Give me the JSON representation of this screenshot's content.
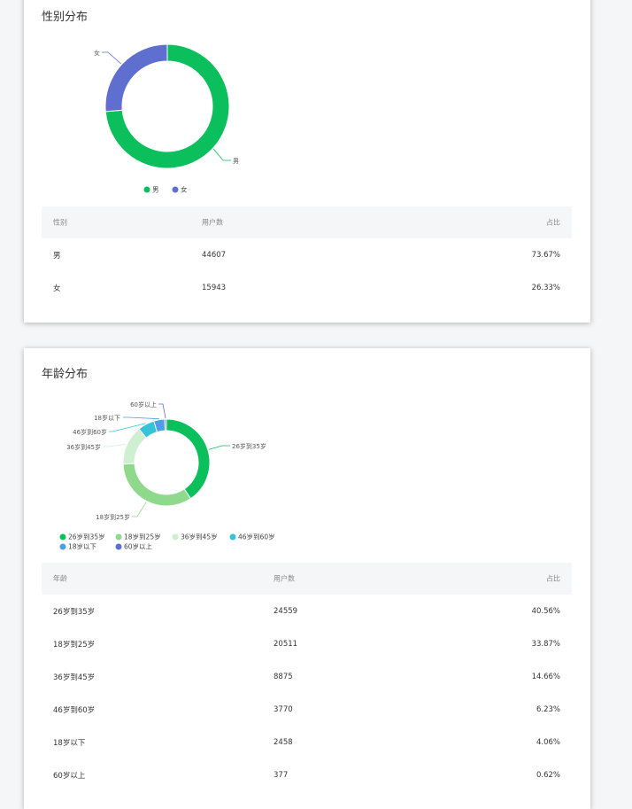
{
  "gender": {
    "title": "性别分布",
    "table_headers": [
      "性别",
      "用户数",
      "占比"
    ],
    "rows": [
      {
        "label": "男",
        "count": "44607",
        "pct": "73.67%"
      },
      {
        "label": "女",
        "count": "15943",
        "pct": "26.33%"
      }
    ]
  },
  "age": {
    "title": "年龄分布",
    "table_headers": [
      "年龄",
      "用户数",
      "占比"
    ],
    "rows": [
      {
        "label": "26岁到35岁",
        "count": "24559",
        "pct": "40.56%"
      },
      {
        "label": "18岁到25岁",
        "count": "20511",
        "pct": "33.87%"
      },
      {
        "label": "36岁到45岁",
        "count": "8875",
        "pct": "14.66%"
      },
      {
        "label": "46岁到60岁",
        "count": "3770",
        "pct": "6.23%"
      },
      {
        "label": "18岁以下",
        "count": "2458",
        "pct": "4.06%"
      },
      {
        "label": "60岁以上",
        "count": "377",
        "pct": "0.62%"
      }
    ]
  },
  "chart_data": [
    {
      "type": "pie",
      "title": "性别分布",
      "categories": [
        "男",
        "女"
      ],
      "values": [
        44607,
        15943
      ],
      "colors": [
        "#0bbf5c",
        "#5f6fcf"
      ],
      "legend": "bottom"
    },
    {
      "type": "pie",
      "title": "年龄分布",
      "categories": [
        "26岁到35岁",
        "18岁到25岁",
        "36岁到45岁",
        "46岁到60岁",
        "18岁以下",
        "60岁以上"
      ],
      "values": [
        24559,
        20511,
        8875,
        3770,
        2458,
        377
      ],
      "colors": [
        "#0bbf5c",
        "#8ed98c",
        "#cfefd1",
        "#34c3d9",
        "#4a9fe6",
        "#5f6fcf"
      ],
      "legend": "bottom"
    }
  ]
}
